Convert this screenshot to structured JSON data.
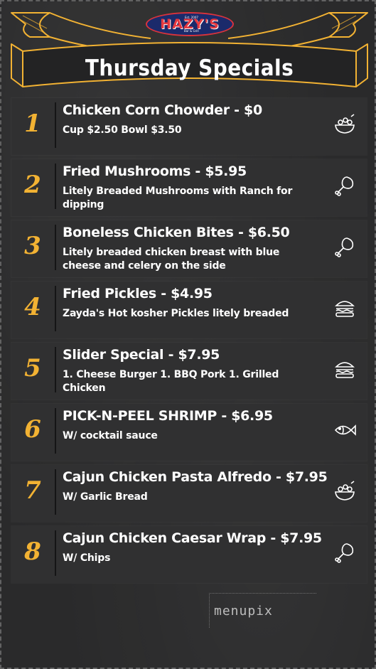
{
  "brand": {
    "logo_text": "HAZY'S",
    "logo_est": "Est. 2007",
    "logo_sub": "Bar & Grill"
  },
  "page_title": "Thursday Specials",
  "colors": {
    "background": "#2a2a2b",
    "number_accent": "#f2b233",
    "banner_outline": "#f2b233",
    "logo_red": "#e53a40",
    "logo_blue": "#1b2a6b"
  },
  "menu_items": [
    {
      "number": "1",
      "title": "Chicken Corn Chowder  - $0",
      "description": "Cup $2.50 Bowl $3.50",
      "icon": "salad-bowl-icon"
    },
    {
      "number": "2",
      "title": "Fried Mushrooms - $5.95",
      "description": "Litely Breaded Mushrooms with Ranch for dipping",
      "icon": "chicken-leg-icon"
    },
    {
      "number": "3",
      "title": "Boneless Chicken Bites  - $6.50",
      "description": "Litely breaded chicken breast with blue cheese and celery on the side",
      "icon": "chicken-leg-icon"
    },
    {
      "number": "4",
      "title": "Fried Pickles - $4.95",
      "description": "Zayda's Hot kosher Pickles litely breaded",
      "icon": "burger-icon"
    },
    {
      "number": "5",
      "title": "Slider Special - $7.95",
      "description": "1. Cheese Burger 1. BBQ Pork 1. Grilled Chicken",
      "icon": "burger-icon"
    },
    {
      "number": "6",
      "title": "PICK-N-PEEL SHRIMP - $6.95",
      "description": "W/ cocktail sauce",
      "icon": "fish-icon"
    },
    {
      "number": "7",
      "title": "Cajun Chicken Pasta Alfredo - $7.95",
      "description": "W/ Garlic Bread",
      "icon": "salad-bowl-icon"
    },
    {
      "number": "8",
      "title": "Cajun Chicken Caesar Wrap - $7.95",
      "description": "W/ Chips",
      "icon": "chicken-leg-icon"
    }
  ],
  "watermark": "menupix"
}
